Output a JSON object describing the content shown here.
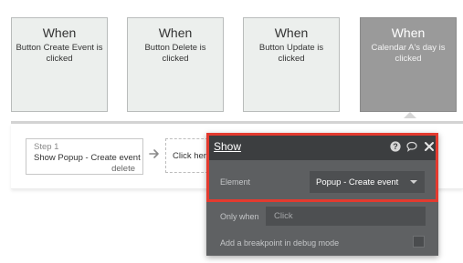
{
  "events": [
    {
      "title": "When",
      "description": "Button Create Event is clicked"
    },
    {
      "title": "When",
      "description": "Button Delete is clicked"
    },
    {
      "title": "When",
      "description": "Button Update is clicked"
    },
    {
      "title": "When",
      "description": "Calendar A's day is clicked"
    }
  ],
  "step": {
    "number_label": "Step 1",
    "title": "Show Popup - Create event",
    "delete_label": "delete"
  },
  "add_step": {
    "label": "Click here to add an action..."
  },
  "panel": {
    "title": "Show",
    "element_label": "Element",
    "element_value": "Popup - Create event",
    "only_when_label": "Only when",
    "only_when_placeholder": "Click",
    "breakpoint_label": "Add a breakpoint in debug mode"
  },
  "colors": {
    "selected_event": "#9a9a9a",
    "panel_bg": "#5f6163",
    "panel_header": "#3c3e40",
    "highlight": "#e43a2f"
  }
}
